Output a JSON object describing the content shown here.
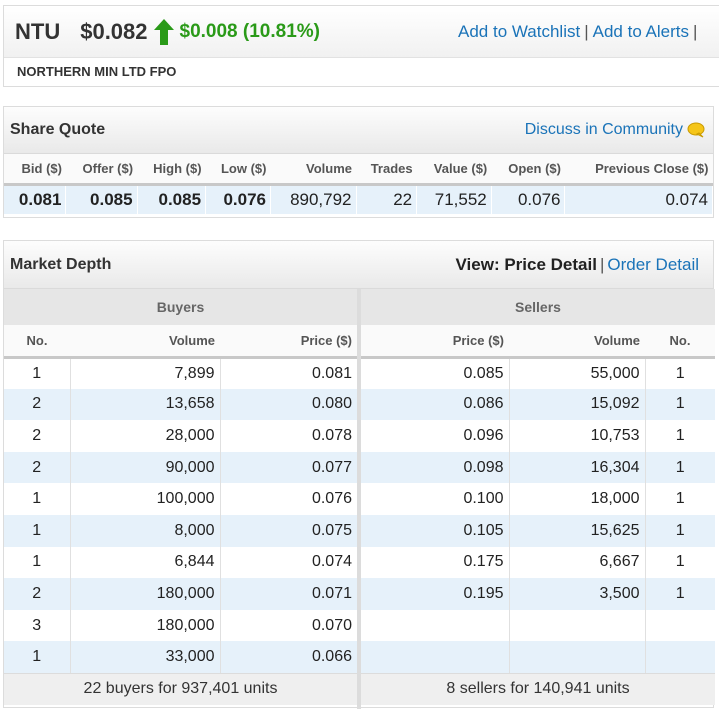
{
  "header": {
    "ticker": "NTU",
    "price": "$0.082",
    "change": "$0.008 (10.81%)",
    "company": "NORTHERN MIN LTD FPO",
    "links": {
      "watchlist": "Add to Watchlist",
      "alerts": "Add to Alerts",
      "sep": "|"
    },
    "up_icon": "up-arrow-icon",
    "colors": {
      "up": "#2a9a18",
      "link": "#1a73b8"
    }
  },
  "quote": {
    "title": "Share Quote",
    "discuss": "Discuss in Community",
    "discuss_icon": "speech-bubble-icon",
    "headers": [
      "Bid ($)",
      "Offer ($)",
      "High ($)",
      "Low ($)",
      "Volume",
      "Trades",
      "Value ($)",
      "Open ($)",
      "Previous Close ($)"
    ],
    "values": [
      "0.081",
      "0.085",
      "0.085",
      "0.076",
      "890,792",
      "22",
      "71,552",
      "0.076",
      "0.074"
    ]
  },
  "depth": {
    "title": "Market Depth",
    "view_label": "View: Price Detail",
    "sep": "|",
    "order_link": "Order Detail",
    "buyers": {
      "title": "Buyers",
      "headers": [
        "No.",
        "Volume",
        "Price ($)"
      ],
      "rows": [
        [
          "1",
          "7,899",
          "0.081"
        ],
        [
          "2",
          "13,658",
          "0.080"
        ],
        [
          "2",
          "28,000",
          "0.078"
        ],
        [
          "2",
          "90,000",
          "0.077"
        ],
        [
          "1",
          "100,000",
          "0.076"
        ],
        [
          "1",
          "8,000",
          "0.075"
        ],
        [
          "1",
          "6,844",
          "0.074"
        ],
        [
          "2",
          "180,000",
          "0.071"
        ],
        [
          "3",
          "180,000",
          "0.070"
        ],
        [
          "1",
          "33,000",
          "0.066"
        ]
      ],
      "summary": "22 buyers for 937,401 units"
    },
    "sellers": {
      "title": "Sellers",
      "headers": [
        "Price ($)",
        "Volume",
        "No."
      ],
      "rows": [
        [
          "0.085",
          "55,000",
          "1"
        ],
        [
          "0.086",
          "15,092",
          "1"
        ],
        [
          "0.096",
          "10,753",
          "1"
        ],
        [
          "0.098",
          "16,304",
          "1"
        ],
        [
          "0.100",
          "18,000",
          "1"
        ],
        [
          "0.105",
          "15,625",
          "1"
        ],
        [
          "0.175",
          "6,667",
          "1"
        ],
        [
          "0.195",
          "3,500",
          "1"
        ],
        [
          "",
          "",
          ""
        ],
        [
          "",
          "",
          ""
        ]
      ],
      "summary": "8 sellers for 140,941 units"
    }
  }
}
